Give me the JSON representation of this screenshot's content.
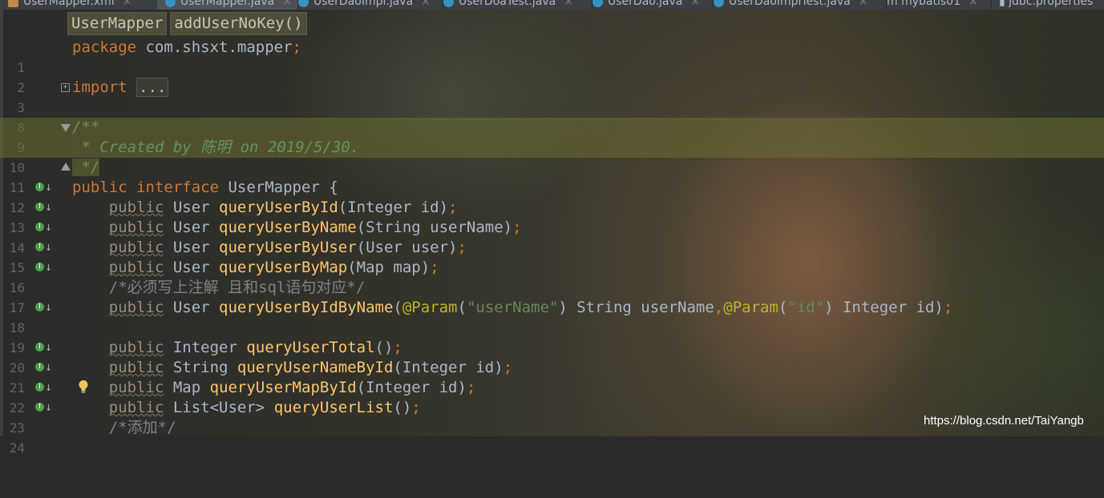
{
  "tabs": [
    {
      "label": "UserMapper.xml",
      "kind": "xml"
    },
    {
      "label": "UserMapper.java",
      "kind": "java",
      "active": true
    },
    {
      "label": "UserDaoImpl.java",
      "kind": "java"
    },
    {
      "label": "UserDoaTest.java",
      "kind": "java"
    },
    {
      "label": "UserDao.java",
      "kind": "java"
    },
    {
      "label": "UserDaoImplTest.java",
      "kind": "java"
    },
    {
      "label": "mybatis01",
      "kind": "module"
    },
    {
      "label": "jdbc.properties",
      "kind": "props"
    }
  ],
  "breadcrumb": {
    "class_name": "UserMapper",
    "method_name": "addUserNoKey()"
  },
  "code": {
    "l1": {
      "num": "1",
      "t": [
        "package",
        " com.shsxt.mapper",
        ";"
      ]
    },
    "l2": {
      "num": "2"
    },
    "l3": {
      "num": "3",
      "t": [
        "import",
        " ",
        "..."
      ]
    },
    "l4": {
      "num": "8"
    },
    "l5": {
      "num": "9",
      "t": [
        "/**"
      ]
    },
    "l6": {
      "num": "10",
      "t": [
        " * Created by 陈明 on 2019/5/30."
      ]
    },
    "l7": {
      "num": "11",
      "t": [
        " */"
      ]
    },
    "l8": {
      "num": "12",
      "t": [
        "public",
        " ",
        "interface",
        " UserMapper {"
      ]
    },
    "l9": {
      "num": "13",
      "t": [
        "    ",
        "public",
        " User ",
        "queryUserById",
        "(Integer id)",
        ";"
      ]
    },
    "l10": {
      "num": "14",
      "t": [
        "    ",
        "public",
        " User ",
        "queryUserByName",
        "(String userName)",
        ";"
      ]
    },
    "l11": {
      "num": "15",
      "t": [
        "    ",
        "public",
        " User ",
        "queryUserByUser",
        "(User user)",
        ";"
      ]
    },
    "l12": {
      "num": "16",
      "t": [
        "    ",
        "public",
        " User ",
        "queryUserByMap",
        "(Map map)",
        ";"
      ]
    },
    "l13": {
      "num": "17",
      "t": [
        "    ",
        "/*必须写上注解 且和sql语句对应*/"
      ]
    },
    "l14": {
      "num": "18",
      "t": [
        "    ",
        "public",
        " User ",
        "queryUserByIdByName",
        "(",
        "@Param",
        "(",
        "\"userName\"",
        ") String userName",
        ",",
        "@Param",
        "(",
        "\"id\"",
        ") Integer id)",
        ";"
      ]
    },
    "l15": {
      "num": "19"
    },
    "l16": {
      "num": "20",
      "t": [
        "    ",
        "public",
        " Integer ",
        "queryUserTotal",
        "()",
        ";"
      ]
    },
    "l17": {
      "num": "21",
      "t": [
        "    ",
        "public",
        " String ",
        "queryUserNameById",
        "(Integer id)",
        ";"
      ]
    },
    "l18": {
      "num": "22",
      "t": [
        "    ",
        "public",
        " Map ",
        "queryUserMapById",
        "(Integer id)",
        ";"
      ]
    },
    "l19": {
      "num": "23",
      "t": [
        "    ",
        "public",
        " List<User> ",
        "queryUserList",
        "()",
        ";"
      ]
    },
    "l20": {
      "num": "24",
      "t": [
        "    ",
        "/*添加*/"
      ]
    }
  },
  "watermark": "https://blog.csdn.net/TaiYangb",
  "icons": {
    "implemented": "implemented-method-icon",
    "arrow": "arrow-down-icon",
    "bulb": "lightbulb-icon",
    "fold": "fold-icon"
  },
  "colors": {
    "keyword": "#cc7832",
    "method": "#ffc66d",
    "string": "#6a8759",
    "annotation": "#bbb529",
    "comment": "#808080",
    "doc_comment": "#629755",
    "plain": "#a9b7c6"
  }
}
